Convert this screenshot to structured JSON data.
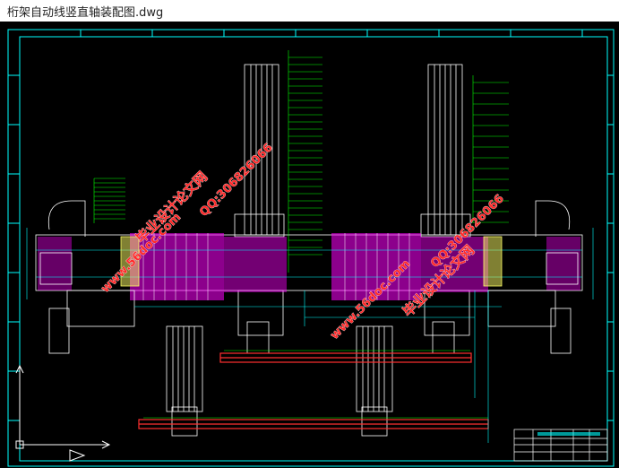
{
  "window": {
    "title": "桁架自动线竖直轴装配图.dwg"
  },
  "colors": {
    "background": "#000000",
    "frame": "#00ffff",
    "magenta": "#ff00ff",
    "white": "#ffffff",
    "green": "#00ff00",
    "red": "#ff3030",
    "yellow": "#ffff66",
    "watermark": "#ff2a2a"
  },
  "watermarks": [
    {
      "text": "毕业设计论文网"
    },
    {
      "text": "www.56doc.com"
    },
    {
      "text": "QQ:306826066"
    },
    {
      "text": "毕业设计论文网"
    },
    {
      "text": "www.56doc.com"
    },
    {
      "text": "QQ:306826066"
    }
  ],
  "icons": {
    "ucs_icon": "ucs-axis-icon",
    "navigation": "nav-arrow-icon"
  }
}
